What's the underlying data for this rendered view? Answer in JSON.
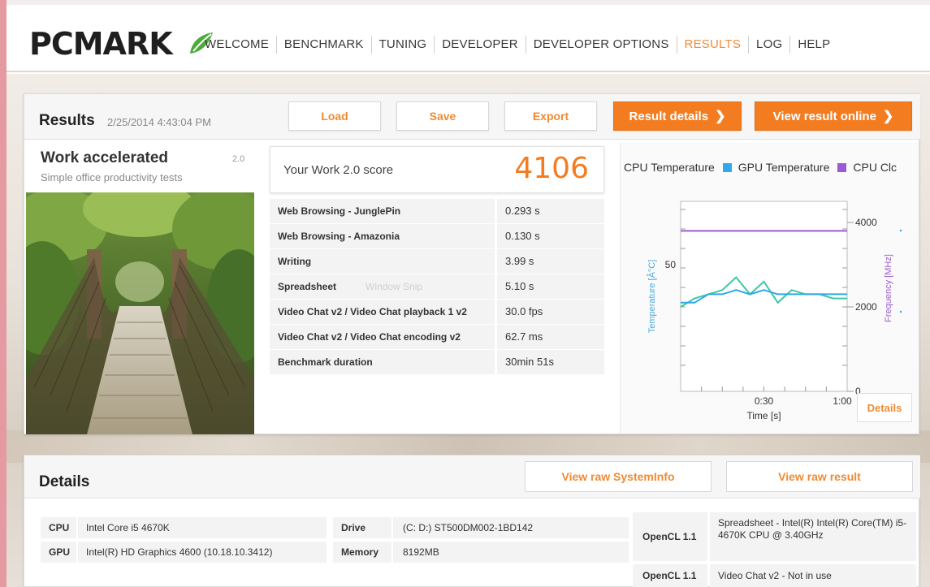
{
  "nav": {
    "logo": "PCMARK",
    "items": [
      "WELCOME",
      "BENCHMARK",
      "TUNING",
      "DEVELOPER",
      "DEVELOPER OPTIONS",
      "RESULTS",
      "LOG",
      "HELP"
    ],
    "active": "RESULTS"
  },
  "results": {
    "title": "Results",
    "date": "2/25/2014 4:43:04 PM",
    "load_label": "Load",
    "save_label": "Save",
    "export_label": "Export",
    "result_details_label": "Result details",
    "view_online_label": "View result online"
  },
  "test": {
    "name": "Work accelerated",
    "version": "2.0",
    "subtitle": "Simple office productivity tests"
  },
  "score": {
    "label": "Your Work 2.0 score",
    "value": "4106"
  },
  "subscores": [
    {
      "name": "Web Browsing - JunglePin",
      "value": "0.293 s"
    },
    {
      "name": "Web Browsing - Amazonia",
      "value": "0.130 s"
    },
    {
      "name": "Writing",
      "value": "3.99 s"
    },
    {
      "name": "Spreadsheet",
      "value": "5.10 s"
    },
    {
      "name": "Video Chat v2 / Video Chat playback 1 v2",
      "value": "30.0 fps"
    },
    {
      "name": "Video Chat v2 / Video Chat encoding v2",
      "value": "62.7 ms"
    },
    {
      "name": "Benchmark duration",
      "value": "30min 51s"
    }
  ],
  "snip_overlay": "Window Snip",
  "chart": {
    "legend": [
      {
        "name": "CPU Temperature",
        "color": "#3fc7a8"
      },
      {
        "name": "GPU Temperature",
        "color": "#2fa9e8"
      },
      {
        "name": "CPU Clc",
        "color": "#9a5cd0"
      }
    ],
    "ylabel_left": "Temperature [Â°C]",
    "ylabel_right": "Frequency [MHz]",
    "xlabel": "Time [s]",
    "left_tick": "50",
    "right_ticks": [
      "4000",
      "2000",
      "0"
    ],
    "x_ticks": [
      "0:30",
      "1:00"
    ],
    "details_label": "Details"
  },
  "chart_data": {
    "type": "line",
    "x": [
      0,
      5,
      10,
      15,
      20,
      25,
      30,
      35,
      40,
      45,
      50,
      55,
      60
    ],
    "series": [
      {
        "name": "CPU Temperature",
        "values": [
          40,
          42,
          43,
          44,
          47,
          43,
          46,
          41,
          44,
          43,
          43,
          42,
          42
        ]
      },
      {
        "name": "GPU Temperature",
        "values": [
          41,
          41,
          43,
          43,
          44,
          43,
          44,
          43,
          43,
          43,
          43,
          43,
          43
        ]
      },
      {
        "name": "CPU Clc",
        "values": [
          3800,
          3800,
          3800,
          3800,
          3800,
          3800,
          3800,
          3800,
          3800,
          3800,
          3800,
          3800,
          3800
        ]
      }
    ],
    "xlabel": "Time [s]",
    "ylabel": "Temperature [Â°C]",
    "ylabel_right": "Frequency [MHz]",
    "xlim": [
      0,
      60
    ],
    "ylim_right": [
      0,
      4500
    ],
    "grid": false
  },
  "details": {
    "title": "Details",
    "raw_sysinfo_label": "View raw SystemInfo",
    "raw_result_label": "View raw result",
    "cpu_key": "CPU",
    "cpu_val": "Intel Core i5 4670K",
    "gpu_key": "GPU",
    "gpu_val": "Intel(R) HD Graphics 4600 (10.18.10.3412)",
    "drive_key": "Drive",
    "drive_val": "(C: D:) ST500DM002-1BD142",
    "memory_key": "Memory",
    "memory_val": "8192MB",
    "opencl": [
      {
        "key": "OpenCL 1.1",
        "val": "Spreadsheet - Intel(R) Intel(R) Core(TM) i5-4670K CPU @ 3.40GHz"
      },
      {
        "key": "OpenCL 1.1",
        "val": "Video Chat v2 - Not in use"
      }
    ]
  }
}
